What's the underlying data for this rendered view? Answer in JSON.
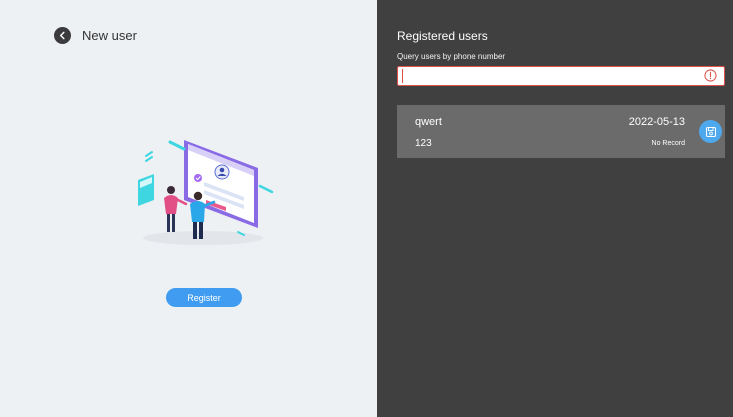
{
  "left_panel": {
    "title": "New user",
    "register_label": "Register"
  },
  "right_panel": {
    "title": "Registered users",
    "search": {
      "label": "Query users by phone number",
      "value": "",
      "placeholder": ""
    },
    "users": [
      {
        "name": "qwert",
        "phone": "123",
        "date": "2022-05-13",
        "record_status": "No Record"
      }
    ]
  },
  "icons": {
    "back": "chevron-left-icon",
    "alert": "alert-circle-icon",
    "record": "save-disk-icon",
    "illustration": "user-registration-illustration"
  },
  "colors": {
    "left_background": "#eef1f4",
    "right_background": "#404040",
    "card_background": "#6b6b6b",
    "accent_blue": "#3f9cf0",
    "error_red": "#e0524c"
  }
}
